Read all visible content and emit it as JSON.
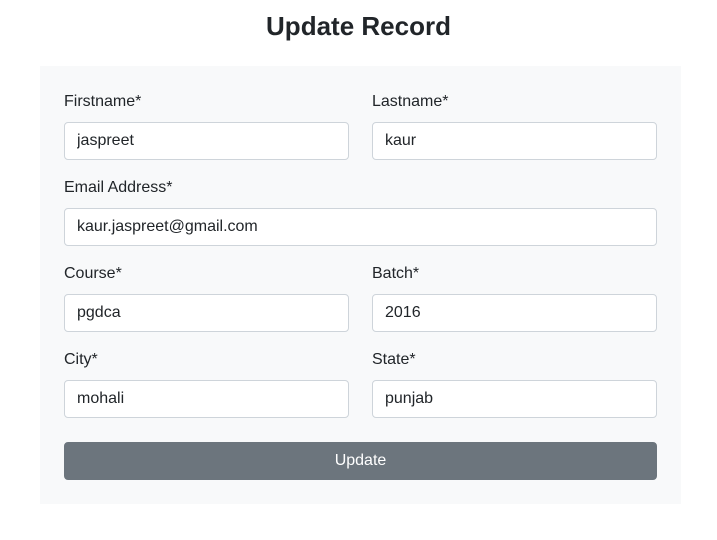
{
  "page": {
    "title": "Update Record"
  },
  "form": {
    "firstname": {
      "label": "Firstname*",
      "value": "jaspreet"
    },
    "lastname": {
      "label": "Lastname*",
      "value": "kaur"
    },
    "email": {
      "label": "Email Address*",
      "value": "kaur.jaspreet@gmail.com"
    },
    "course": {
      "label": "Course*",
      "value": "pgdca"
    },
    "batch": {
      "label": "Batch*",
      "value": "2016"
    },
    "city": {
      "label": "City*",
      "value": "mohali"
    },
    "state": {
      "label": "State*",
      "value": "punjab"
    },
    "submit_label": "Update"
  },
  "colors": {
    "card_background": "#f8f9fa",
    "input_border": "#ced4da",
    "button_background": "#6c757d",
    "button_text": "#ffffff"
  }
}
